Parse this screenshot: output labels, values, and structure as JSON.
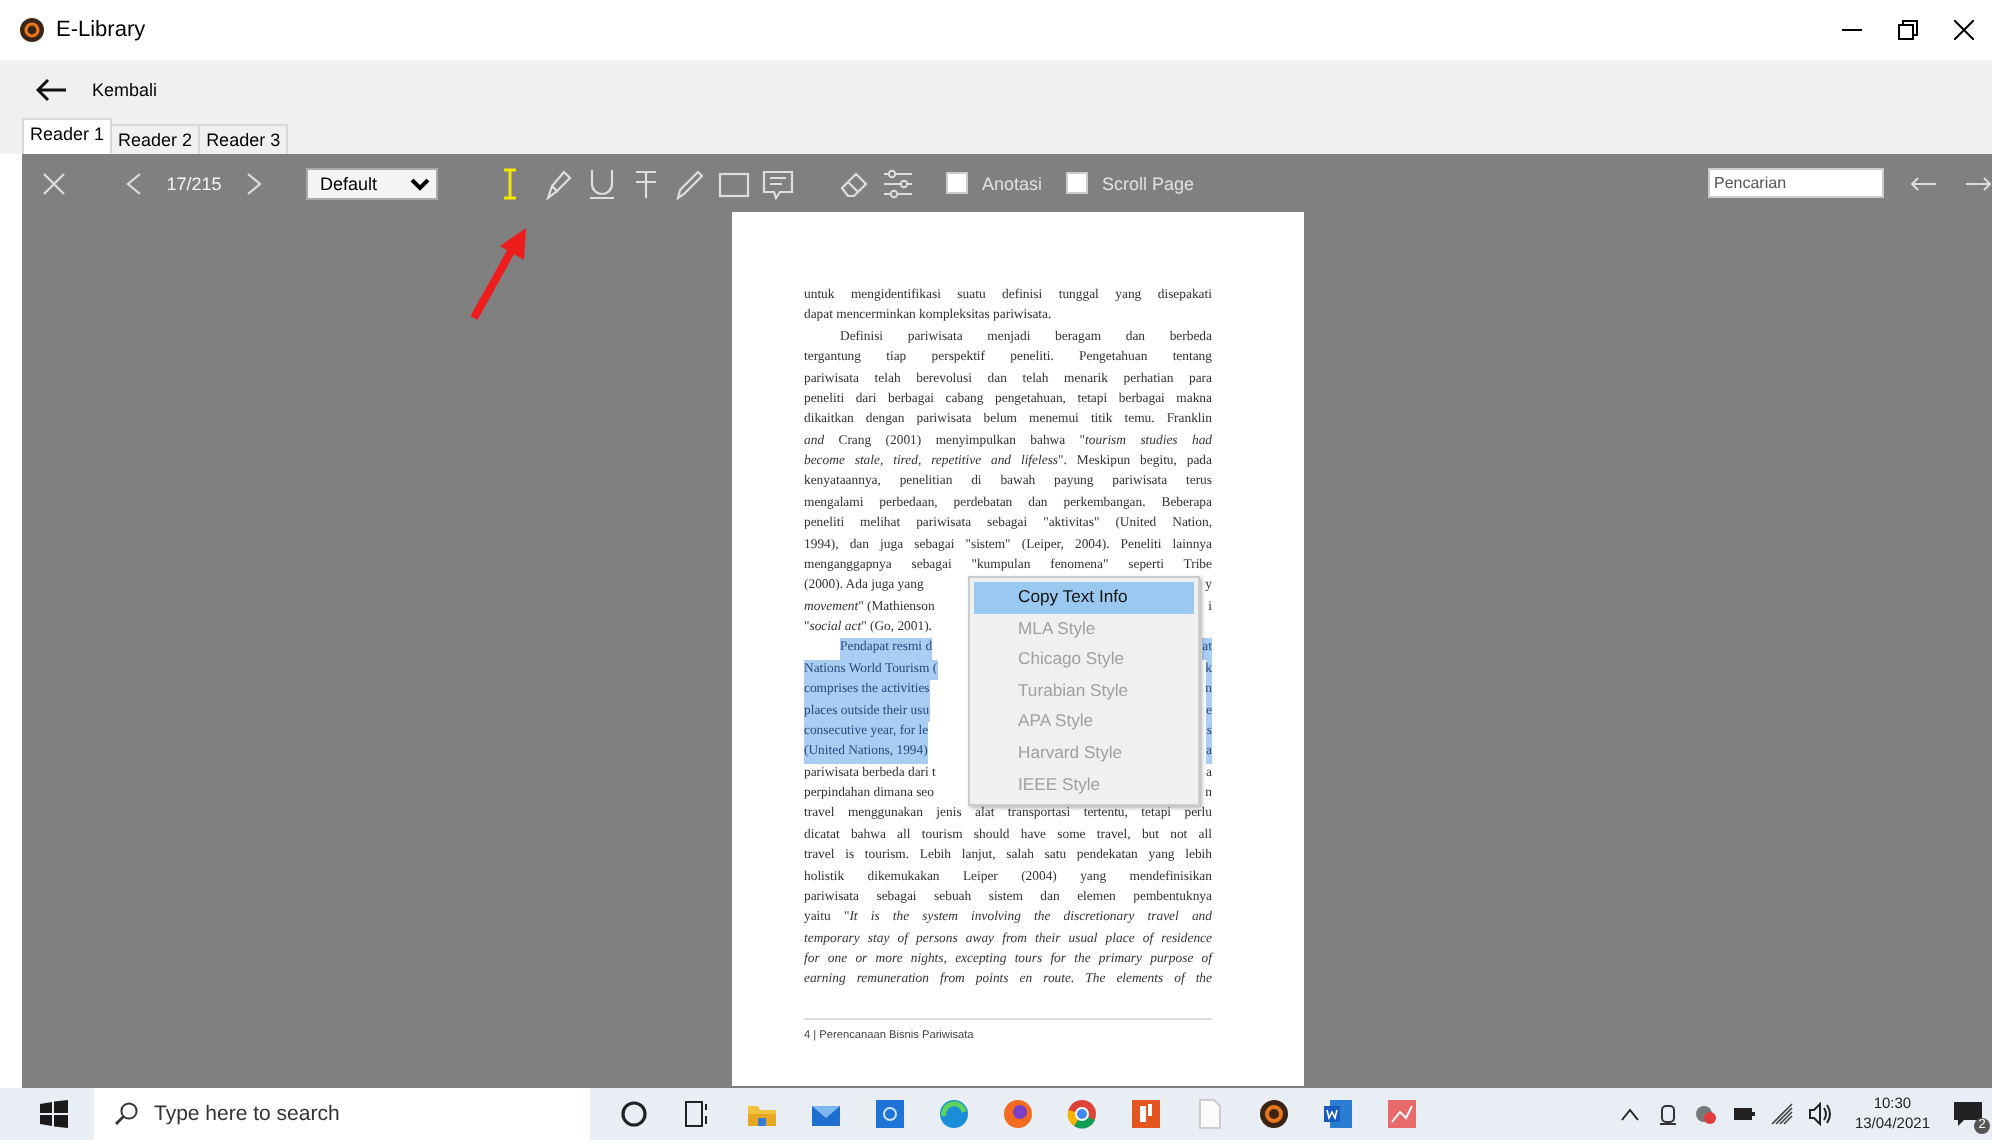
{
  "window": {
    "title": "E-Library"
  },
  "nav": {
    "back_label": "Kembali"
  },
  "tabs": [
    {
      "label": "Reader 1",
      "selected": true
    },
    {
      "label": "Reader 2",
      "selected": false
    },
    {
      "label": "Reader 3",
      "selected": false
    }
  ],
  "toolbar": {
    "page": "17/215",
    "zoom": "Default",
    "tools": [
      {
        "kind": "text-cursor",
        "selected": true
      },
      {
        "kind": "highlighter",
        "selected": false
      },
      {
        "kind": "underline",
        "selected": false
      },
      {
        "kind": "strikethrough",
        "selected": false
      },
      {
        "kind": "pencil",
        "selected": false
      },
      {
        "kind": "rectangle",
        "selected": false
      },
      {
        "kind": "comment",
        "selected": false
      },
      {
        "kind": "eraser",
        "selected": false
      },
      {
        "kind": "sliders",
        "selected": false
      }
    ],
    "checkboxes": [
      {
        "label": "Anotasi",
        "checked": false
      },
      {
        "label": "Scroll Page",
        "checked": false
      }
    ],
    "search": {
      "placeholder": "Pencarian"
    }
  },
  "document": {
    "lines": [
      {
        "kind": "full",
        "text": "untuk mengidentifikasi suatu definisi tunggal yang disepakati",
        "highlighted": false
      },
      {
        "kind": "end",
        "text": "dapat mencerminkan kompleksitas pariwisata.",
        "highlighted": false
      },
      {
        "kind": "indent",
        "text": "Definisi pariwisata menjadi beragam dan berbeda",
        "highlighted": false
      },
      {
        "kind": "full",
        "text": "tergantung tiap perspektif peneliti. Pengetahuan tentang",
        "highlighted": false
      },
      {
        "kind": "full",
        "text": "pariwisata telah berevolusi dan telah menarik perhatian para",
        "highlighted": false
      },
      {
        "kind": "full",
        "text": "peneliti dari berbagai cabang pengetahuan, tetapi berbagai makna",
        "highlighted": false
      },
      {
        "kind": "full",
        "text": "dikaitkan dengan pariwisata belum menemui titik temu. Franklin",
        "highlighted": false
      },
      {
        "kind": "full",
        "text": "*and* Crang (2001) menyimpulkan bahwa \"*tourism studies had*",
        "highlighted": false
      },
      {
        "kind": "full",
        "text": "*become stale, tired, repetitive and lifeless*\". Meskipun begitu, pada",
        "highlighted": false
      },
      {
        "kind": "full",
        "text": "kenyataannya, penelitian di bawah payung pariwisata terus",
        "highlighted": false
      },
      {
        "kind": "full",
        "text": "mengalami perbedaan, perdebatan dan perkembangan. Beberapa",
        "highlighted": false
      },
      {
        "kind": "full",
        "text": "peneliti melihat pariwisata sebagai \"aktivitas\" (United Nation,",
        "highlighted": false
      },
      {
        "kind": "full",
        "text": "1994), dan juga sebagai \"sistem\" (Leiper, 2004). Peneliti lainnya",
        "highlighted": false
      },
      {
        "kind": "full",
        "text": "menganggapnya sebagai \"kumpulan fenomena\" seperti Tribe",
        "highlighted": false
      },
      {
        "kind": "split",
        "left": "(2000). Ada juga yang",
        "right": "y",
        "highlighted": false
      },
      {
        "kind": "split",
        "left": "*movement*\" (Mathienson",
        "right": "i",
        "highlighted": false
      },
      {
        "kind": "end",
        "text": "\"*social act*\" (Go, 2001).",
        "highlighted": false
      },
      {
        "kind": "split-indent",
        "left": "Pendapat resmi d",
        "right": "at",
        "highlighted": true
      },
      {
        "kind": "split",
        "left": "Nations World Tourism (",
        "right": "k",
        "highlighted": true
      },
      {
        "kind": "split",
        "left": "comprises the activities",
        "right": "n",
        "highlighted": true
      },
      {
        "kind": "split",
        "left": "places outside their usu",
        "right": "e",
        "highlighted": true
      },
      {
        "kind": "split",
        "left": "consecutive year, for le",
        "right": "s",
        "highlighted": true
      },
      {
        "kind": "split",
        "left": "(United Nations, 1994)",
        "right": "a",
        "highlighted": true
      },
      {
        "kind": "split",
        "left": "pariwisata berbeda dari t",
        "right": "a",
        "highlighted": false
      },
      {
        "kind": "split",
        "left": "perpindahan dimana seo",
        "right": "n",
        "highlighted": false
      },
      {
        "kind": "full",
        "text": "travel menggunakan jenis alat transportasi tertentu, tetapi perlu",
        "highlighted": false
      },
      {
        "kind": "full",
        "text": "dicatat bahwa all tourism should have some travel, but not all",
        "highlighted": false
      },
      {
        "kind": "full",
        "text": "travel is tourism. Lebih lanjut, salah satu pendekatan yang lebih",
        "highlighted": false
      },
      {
        "kind": "full",
        "text": "holistik dikemukakan Leiper (2004) yang mendefinisikan",
        "highlighted": false
      },
      {
        "kind": "full",
        "text": "pariwisata sebagai sebuah sistem dan elemen pembentuknya",
        "highlighted": false
      },
      {
        "kind": "full",
        "text": "yaitu \"*It is the system involving the discretionary travel and*",
        "highlighted": false
      },
      {
        "kind": "full",
        "text": "*temporary stay of persons away from their usual place of residence*",
        "highlighted": false
      },
      {
        "kind": "full",
        "text": "*for one or more nights, excepting tours for the primary purpose of*",
        "highlighted": false
      },
      {
        "kind": "full",
        "text": "*earning remuneration from points en route. The elements of the*",
        "highlighted": false
      }
    ],
    "footer": "4 | Perencanaan Bisnis Pariwisata"
  },
  "context_menu": {
    "items": [
      {
        "label": "Copy Text Info",
        "selected": true,
        "disabled": false
      },
      {
        "label": "MLA Style",
        "selected": false,
        "disabled": true
      },
      {
        "label": "Chicago Style",
        "selected": false,
        "disabled": true
      },
      {
        "label": "Turabian Style",
        "selected": false,
        "disabled": true
      },
      {
        "label": "APA Style",
        "selected": false,
        "disabled": true
      },
      {
        "label": "Harvard Style",
        "selected": false,
        "disabled": true
      },
      {
        "label": "IEEE Style",
        "selected": false,
        "disabled": true
      }
    ]
  },
  "taskbar": {
    "search": {
      "placeholder": "Type here to search"
    },
    "time": "10:30",
    "date": "13/04/2021",
    "notifications": "2"
  }
}
